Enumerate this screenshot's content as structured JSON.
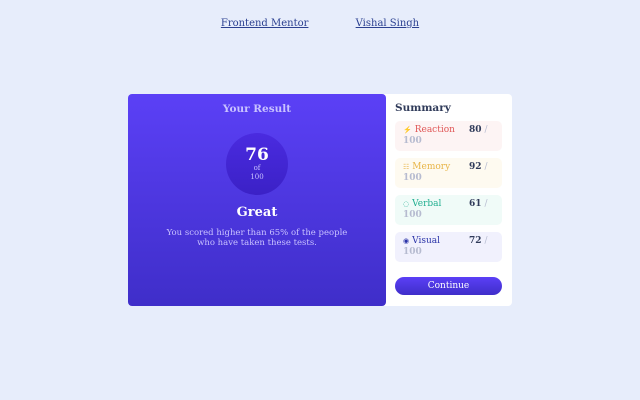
{
  "top_links": {
    "frontend_mentor": "Frontend Mentor",
    "author": "Vishal Singh"
  },
  "result": {
    "title": "Your Result",
    "score": "76",
    "of": "of",
    "total": "100",
    "rating": "Great",
    "description": "You scored higher than 65% of the people who have taken these tests."
  },
  "summary": {
    "title": "Summary",
    "items": [
      {
        "icon": "lightning-icon",
        "glyph": "⚡",
        "label": "Reaction",
        "value": "80",
        "slash": "/",
        "max": "100",
        "color": "#e05757"
      },
      {
        "icon": "brain-icon",
        "glyph": "☷",
        "label": "Memory",
        "value": "92",
        "slash": "/",
        "max": "100",
        "color": "#e8b548"
      },
      {
        "icon": "speech-bubble-icon",
        "glyph": "◌",
        "label": "Verbal",
        "value": "61",
        "slash": "/",
        "max": "100",
        "color": "#1fae8f"
      },
      {
        "icon": "eye-icon",
        "glyph": "◉",
        "label": "Visual",
        "value": "72",
        "slash": "/",
        "max": "100",
        "color": "#2a33a8"
      }
    ],
    "continue_label": "Continue"
  },
  "colors": {
    "background": "#e7edfb",
    "accent_start": "#5b40f6",
    "accent_end": "#3f2ec9"
  }
}
